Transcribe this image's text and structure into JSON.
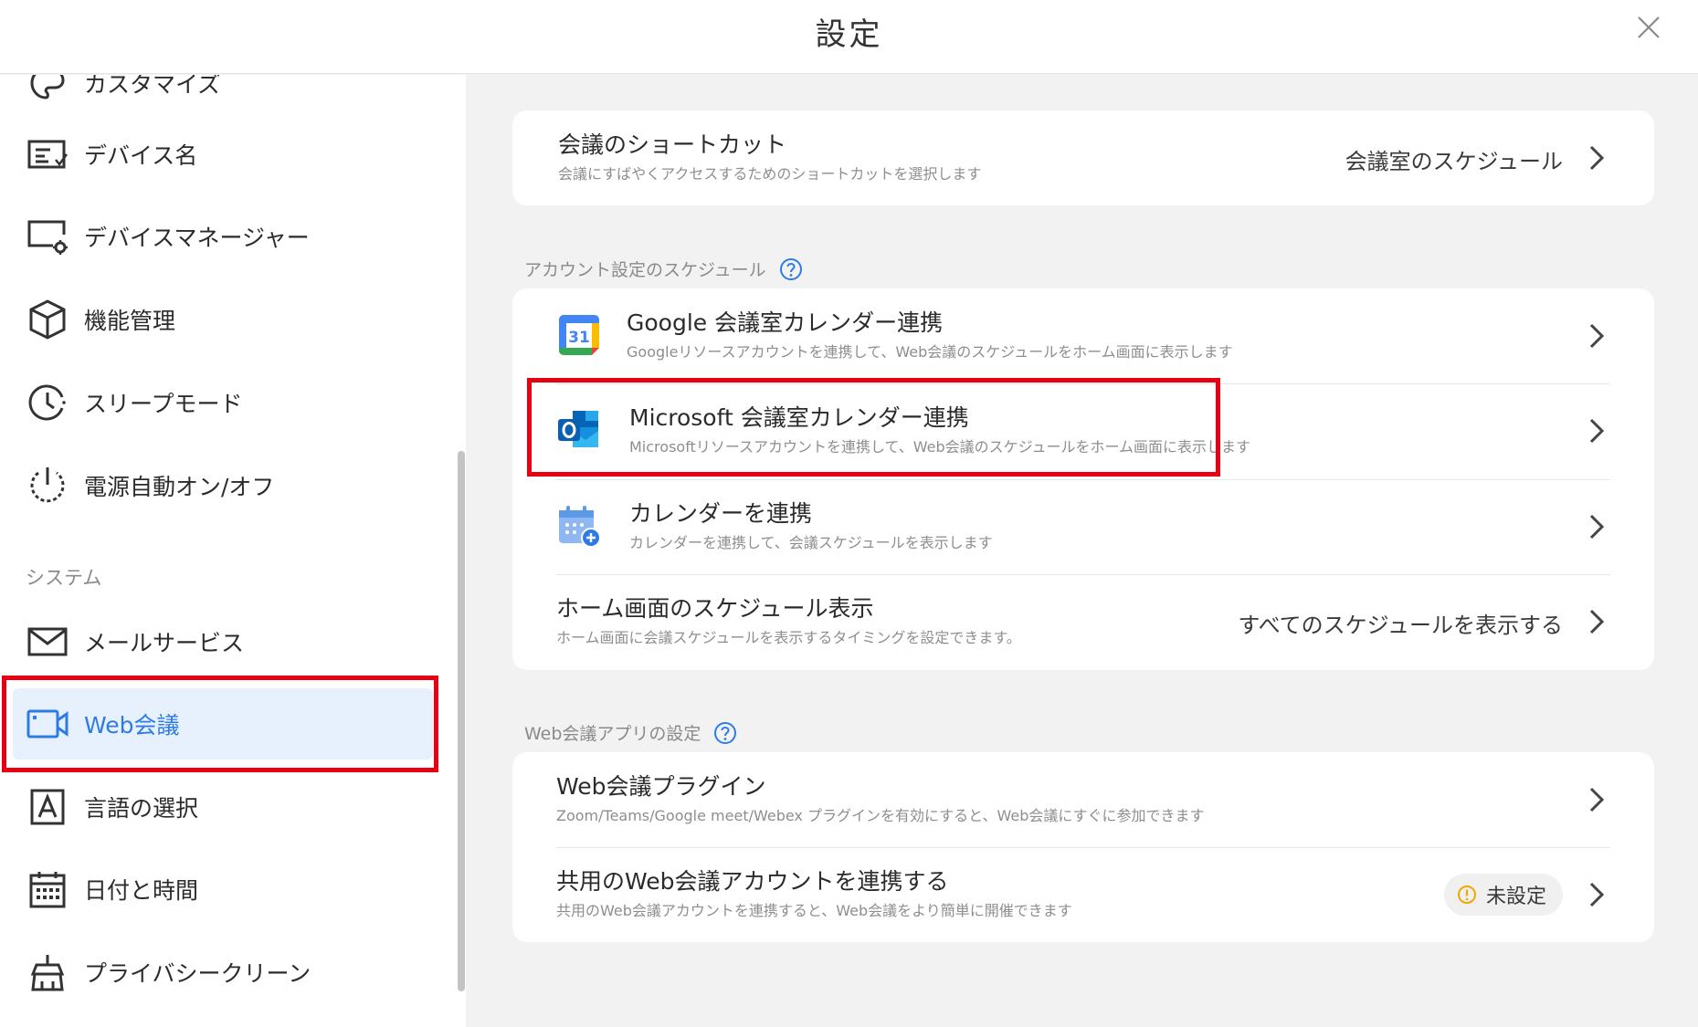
{
  "header": {
    "title": "設定",
    "close_icon": "close-icon"
  },
  "sidebar": {
    "items": [
      {
        "label": "カスタマイズ",
        "icon": "palette-icon"
      },
      {
        "label": "デバイス名",
        "icon": "rename-icon"
      },
      {
        "label": "デバイスマネージャー",
        "icon": "device-manager-icon"
      },
      {
        "label": "機能管理",
        "icon": "cube-icon"
      },
      {
        "label": "スリープモード",
        "icon": "clock-icon"
      },
      {
        "label": "電源自動オン/オフ",
        "icon": "power-icon"
      }
    ],
    "section_system": "システム",
    "system_items": [
      {
        "label": "メールサービス",
        "icon": "mail-icon"
      },
      {
        "label": "Web会議",
        "icon": "video-camera-icon",
        "active": true
      },
      {
        "label": "言語の選択",
        "icon": "language-icon"
      },
      {
        "label": "日付と時間",
        "icon": "calendar-icon"
      },
      {
        "label": "プライバシークリーン",
        "icon": "broom-icon"
      }
    ]
  },
  "main": {
    "shortcut": {
      "title": "会議のショートカット",
      "subtitle": "会議にすばやくアクセスするためのショートカットを選択します",
      "value": "会議室のスケジュール"
    },
    "account_section": {
      "label": "アカウント設定のスケジュール",
      "rows": [
        {
          "title": "Google 会議室カレンダー連携",
          "subtitle": "Googleリソースアカウントを連携して、Web会議のスケジュールをホーム画面に表示します",
          "icon": "google-calendar-icon"
        },
        {
          "title": "Microsoft 会議室カレンダー連携",
          "subtitle": "Microsoftリソースアカウントを連携して、Web会議のスケジュールをホーム画面に表示します",
          "icon": "outlook-icon"
        },
        {
          "title": "カレンダーを連携",
          "subtitle": "カレンダーを連携して、会議スケジュールを表示します",
          "icon": "calendar-add-icon"
        },
        {
          "title": "ホーム画面のスケジュール表示",
          "subtitle": "ホーム画面に会議スケジュールを表示するタイミングを設定できます。",
          "value": "すべてのスケジュールを表示する"
        }
      ]
    },
    "webapp_section": {
      "label": "Web会議アプリの設定",
      "rows": [
        {
          "title": "Web会議プラグイン",
          "subtitle": "Zoom/Teams/Google meet/Webex プラグインを有効にすると、Web会議にすぐに参加できます"
        },
        {
          "title": "共用のWeb会議アカウントを連携する",
          "subtitle": "共用のWeb会議アカウントを連携すると、Web会議をより簡単に開催できます",
          "badge": "未設定"
        }
      ]
    }
  },
  "colors": {
    "accent": "#2e7be5",
    "highlight": "#e60012",
    "active_bg": "#e7f1fd"
  }
}
